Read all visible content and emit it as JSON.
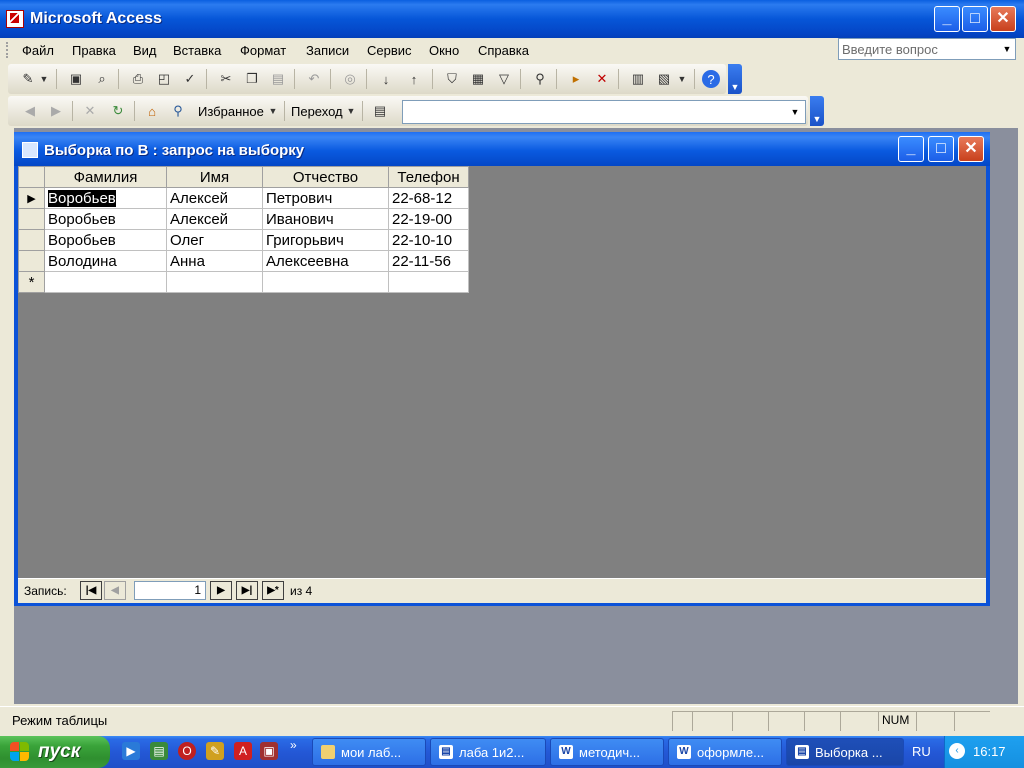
{
  "window": {
    "title": "Microsoft Access",
    "controls": {
      "minimize": "_",
      "maximize": "□",
      "close": "✕"
    }
  },
  "menu": {
    "items": [
      "Файл",
      "Правка",
      "Вид",
      "Вставка",
      "Формат",
      "Записи",
      "Сервис",
      "Окно",
      "Справка"
    ],
    "help_placeholder": "Введите вопрос"
  },
  "toolbar2": {
    "favorites": "Избранное",
    "go": "Переход"
  },
  "query_window": {
    "title": "Выборка по В : запрос на выборку",
    "columns": [
      "Фамилия",
      "Имя",
      "Отчество",
      "Телефон"
    ],
    "rows": [
      [
        "Воробьев",
        "Алексей",
        "Петрович",
        "22-68-12"
      ],
      [
        "Воробьев",
        "Алексей",
        "Иванович",
        "22-19-00"
      ],
      [
        "Воробьев",
        "Олег",
        "Григорьвич",
        "22-10-10"
      ],
      [
        "Володина",
        "Анна",
        "Алексеевна",
        "22-11-56"
      ]
    ],
    "current_marker": "▶",
    "new_marker": "*",
    "record_label": "Запись:",
    "record_number": "1",
    "record_of": "из  4"
  },
  "status": {
    "mode": "Режим таблицы",
    "num": "NUM"
  },
  "taskbar": {
    "start": "пуск",
    "expand": "»",
    "tasks": [
      "мои лаб...",
      "лаба 1и2...",
      "методич...",
      "оформле...",
      "Выборка ..."
    ],
    "lang": "RU",
    "clock": "16:17"
  },
  "colors": {
    "title_blue": "#0656d8",
    "mdi_gray": "#8a8f9d",
    "start_green": "#3aa43a"
  }
}
